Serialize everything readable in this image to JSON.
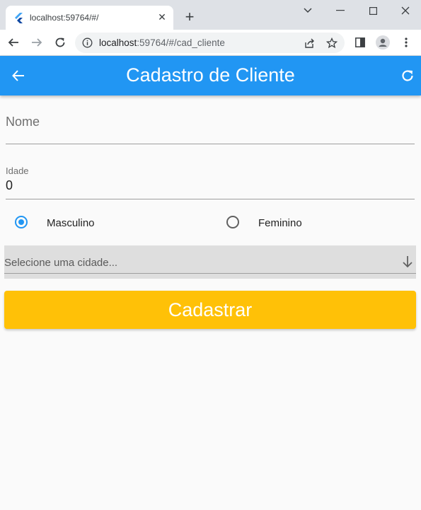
{
  "browser": {
    "tab_title": "localhost:59764/#/",
    "url_host": "localhost",
    "url_path": ":59764/#/cad_cliente"
  },
  "appbar": {
    "title": "Cadastro de Cliente",
    "color": "#2196f3"
  },
  "form": {
    "nome_placeholder": "Nome",
    "idade_label": "Idade",
    "idade_value": "0",
    "gender_options": [
      {
        "label": "Masculino",
        "selected": true
      },
      {
        "label": "Feminino",
        "selected": false
      }
    ],
    "city_placeholder": "Selecione uma cidade...",
    "submit_label": "Cadastrar",
    "submit_color": "#ffc107"
  },
  "icons": {
    "back": "arrow-left-icon",
    "refresh": "refresh-icon",
    "dropdown": "arrow-down-icon"
  }
}
